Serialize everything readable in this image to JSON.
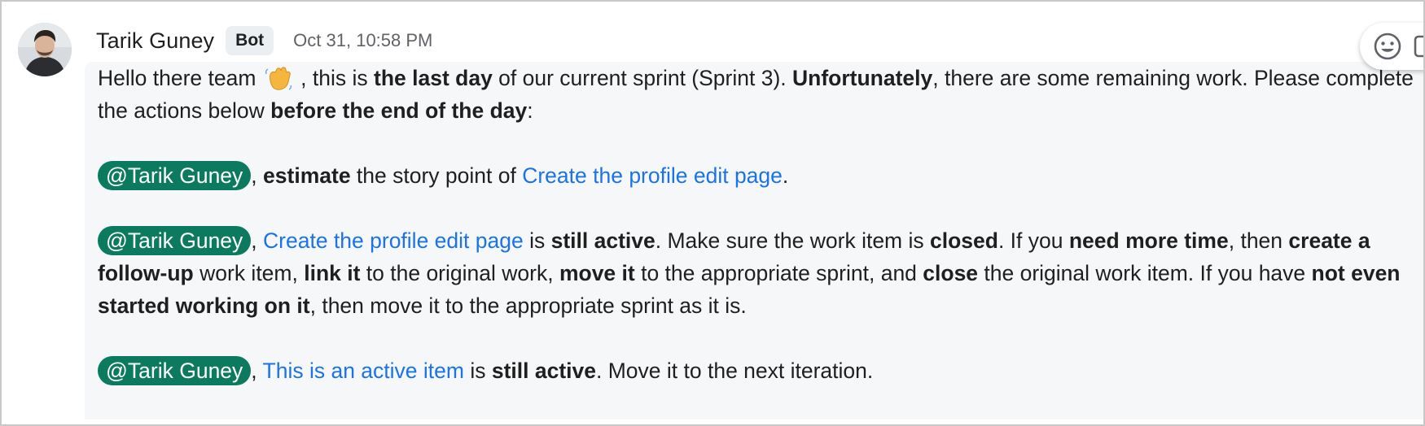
{
  "header": {
    "sender_name": "Tarik Guney",
    "badge": "Bot",
    "timestamp": "Oct 31, 10:58 PM"
  },
  "colors": {
    "mention_bg": "#0b7a5f",
    "link": "#1a73e8",
    "message_bg": "#f6f7f9"
  },
  "toolbar": {
    "icons": [
      "emoji-icon",
      "more-icon"
    ]
  },
  "message": {
    "p1": {
      "t1": "Hello there team ",
      "emoji": "wave-icon",
      "t2": " , this is ",
      "b1": "the last day",
      "t3": " of our current sprint (Sprint 3). ",
      "b2": "Unfortunately",
      "t4": ", there are some remaining work. Please complete the actions below ",
      "b3": "before the end of the day",
      "t5": ":"
    },
    "p2": {
      "mention": "@Tarik Guney",
      "t1": ", ",
      "b1": "estimate",
      "t2": " the story point of ",
      "link": "Create the profile edit page",
      "t3": "."
    },
    "p3": {
      "mention": "@Tarik Guney",
      "t1": ", ",
      "link": "Create the profile edit page",
      "t2": " is ",
      "b1": "still active",
      "t3": ". Make sure the work item is ",
      "b2": "closed",
      "t4": ". If you ",
      "b3": "need more time",
      "t5": ", then ",
      "b4": "create a follow-up",
      "t6": " work item, ",
      "b5": "link it",
      "t7": " to the original work, ",
      "b6": "move it",
      "t8": " to the appropriate sprint, and ",
      "b7": "close",
      "t9": " the original work item. If you have ",
      "b8": "not even started working on it",
      "t10": ", then move it to the appropriate sprint as it is."
    },
    "p4": {
      "mention": "@Tarik Guney",
      "t1": ", ",
      "link": "This is an active item",
      "t2": " is ",
      "b1": "still active",
      "t3": ". Move it to the next iteration."
    }
  }
}
